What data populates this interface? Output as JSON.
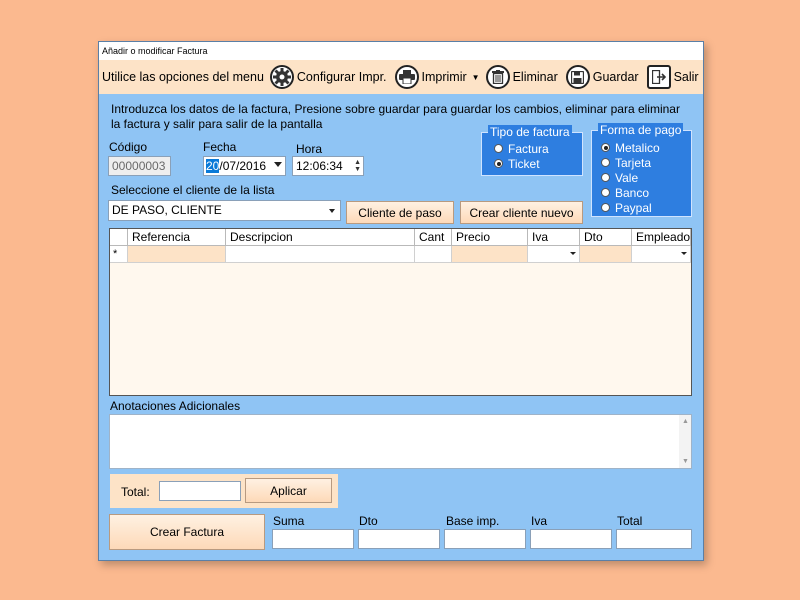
{
  "window": {
    "title": "Añadir o modificar Factura"
  },
  "toolbar": {
    "intro": "Utilice las opciones del menu",
    "configurar": "Configurar Impr.",
    "imprimir": "Imprimir",
    "eliminar": "Eliminar",
    "guardar": "Guardar",
    "salir": "Salir"
  },
  "instructions": {
    "line1": "Introduzca los datos de la factura, Presione sobre guardar para guardar los cambios, eliminar para eliminar",
    "line2": "la factura y salir para salir de la pantalla"
  },
  "form": {
    "codigo_label": "Código",
    "codigo_value": "00000003",
    "fecha_label": "Fecha",
    "fecha_day": "20",
    "fecha_rest": "/07/2016",
    "hora_label": "Hora",
    "hora_value": "12:06:34",
    "cliente_label": "Seleccione el cliente de la lista",
    "cliente_value": "DE PASO, CLIENTE",
    "cliente_paso_btn": "Cliente de paso",
    "crear_cliente_btn": "Crear cliente nuevo"
  },
  "tipo_factura": {
    "title": "Tipo de factura",
    "options": [
      {
        "label": "Factura",
        "selected": false
      },
      {
        "label": "Ticket",
        "selected": true
      }
    ]
  },
  "forma_pago": {
    "title": "Forma de pago",
    "options": [
      {
        "label": "Metalico",
        "selected": true
      },
      {
        "label": "Tarjeta",
        "selected": false
      },
      {
        "label": "Vale",
        "selected": false
      },
      {
        "label": "Banco",
        "selected": false
      },
      {
        "label": "Paypal",
        "selected": false
      }
    ]
  },
  "grid": {
    "columns": [
      "Referencia",
      "Descripcion",
      "Cant",
      "Precio",
      "Iva",
      "Dto",
      "Empleado"
    ],
    "new_row_marker": "*"
  },
  "notes": {
    "label": "Anotaciones Adicionales",
    "value": ""
  },
  "total": {
    "label": "Total:",
    "value": "",
    "apply_btn": "Aplicar"
  },
  "summary": {
    "create_btn": "Crear Factura",
    "fields": [
      {
        "label": "Suma",
        "value": ""
      },
      {
        "label": "Dto",
        "value": ""
      },
      {
        "label": "Base imp.",
        "value": ""
      },
      {
        "label": "Iva",
        "value": ""
      },
      {
        "label": "Total",
        "value": ""
      }
    ]
  },
  "colors": {
    "background": "#fbb98f",
    "window": "#8fc4f4",
    "toolbar": "#fde3c7",
    "groupbox": "#2e7ee0",
    "selection": "#0a7ad8"
  }
}
